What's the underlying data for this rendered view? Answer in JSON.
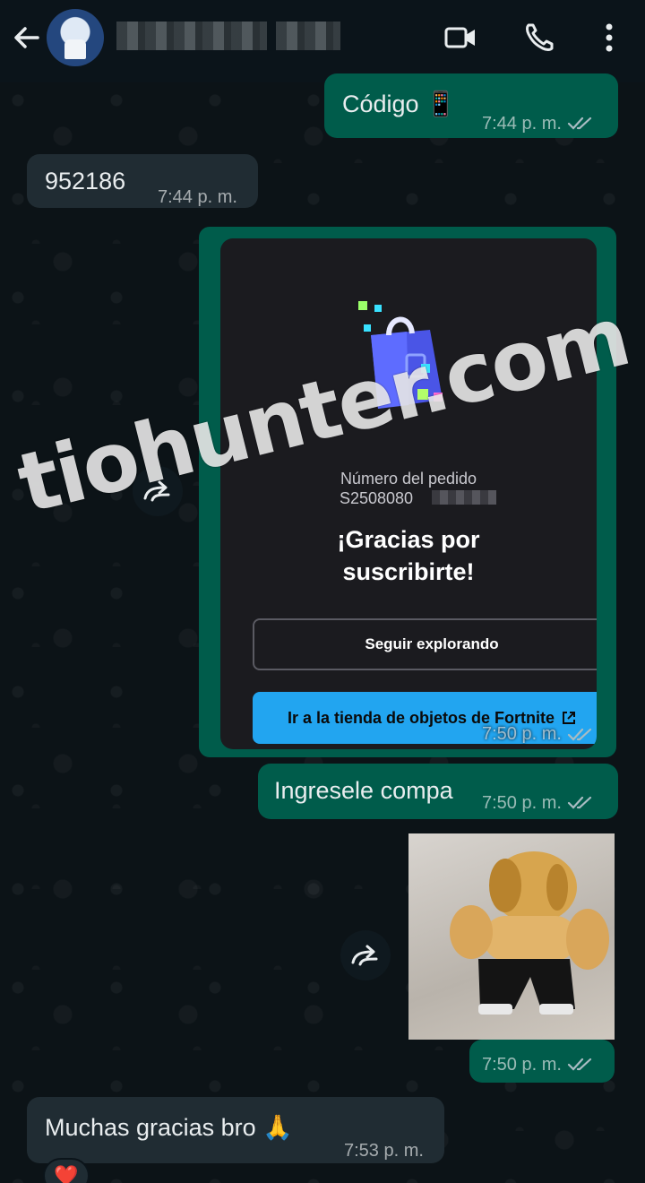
{
  "header": {
    "contact_name": "",
    "back_label": "Back",
    "video_call_label": "Video call",
    "voice_call_label": "Voice call",
    "menu_label": "More options"
  },
  "messages": [
    {
      "id": "m1",
      "direction": "out",
      "text": "Código 📱",
      "time": "7:44 p. m.",
      "status": "read"
    },
    {
      "id": "m2",
      "direction": "in",
      "text": "952186",
      "time": "7:44 p. m."
    },
    {
      "id": "m3",
      "direction": "out",
      "type": "image",
      "time": "7:50 p. m.",
      "status": "read",
      "content": {
        "order_label": "Número del pedido",
        "order_number": "S2508080",
        "thanks_line1": "¡Gracias por",
        "thanks_line2": "suscribirte!",
        "secondary_button": "Seguir explorando",
        "primary_button": "Ir a la tienda de objetos de Fortnite"
      }
    },
    {
      "id": "m4",
      "direction": "out",
      "text": "Ingresele compa",
      "time": "7:50 p. m.",
      "status": "read"
    },
    {
      "id": "m5",
      "direction": "out",
      "type": "sticker",
      "time": "7:50 p. m.",
      "status": "read"
    },
    {
      "id": "m6",
      "direction": "in",
      "text": "Muchas gracias bro 🙏",
      "time": "7:53 p. m.",
      "reaction": "❤️"
    }
  ],
  "watermark": "tiohunter.com",
  "colors": {
    "background": "#0b141a",
    "outgoing_bubble": "#005c4b",
    "incoming_bubble": "#202c33",
    "read_ticks": "#a9bcc3",
    "primary_button": "#22a5f0"
  },
  "icons": [
    "back-arrow-icon",
    "video-camera-icon",
    "phone-icon",
    "more-vertical-icon",
    "forward-icon",
    "double-check-icon",
    "shopping-bag-icon",
    "external-link-icon"
  ]
}
